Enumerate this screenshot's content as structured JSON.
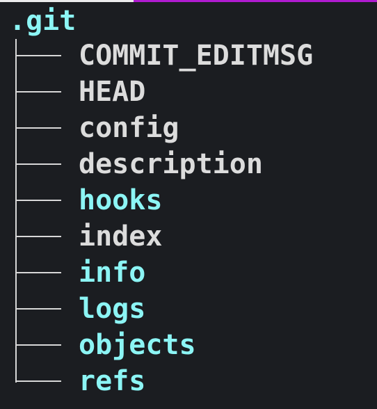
{
  "root": {
    "name": ".git"
  },
  "entries": [
    {
      "name": "COMMIT_EDITMSG",
      "type": "file"
    },
    {
      "name": "HEAD",
      "type": "file"
    },
    {
      "name": "config",
      "type": "file"
    },
    {
      "name": "description",
      "type": "file"
    },
    {
      "name": "hooks",
      "type": "dir"
    },
    {
      "name": "index",
      "type": "file"
    },
    {
      "name": "info",
      "type": "dir"
    },
    {
      "name": "logs",
      "type": "dir"
    },
    {
      "name": "objects",
      "type": "dir"
    },
    {
      "name": "refs",
      "type": "dir"
    }
  ],
  "colors": {
    "background": "#1b1d21",
    "file": "#dcdcdc",
    "directory": "#8cf5f5",
    "tree_lines": "#d8d8d8",
    "tab_active": "#ececec",
    "tab_accent": "#b01bd0"
  }
}
